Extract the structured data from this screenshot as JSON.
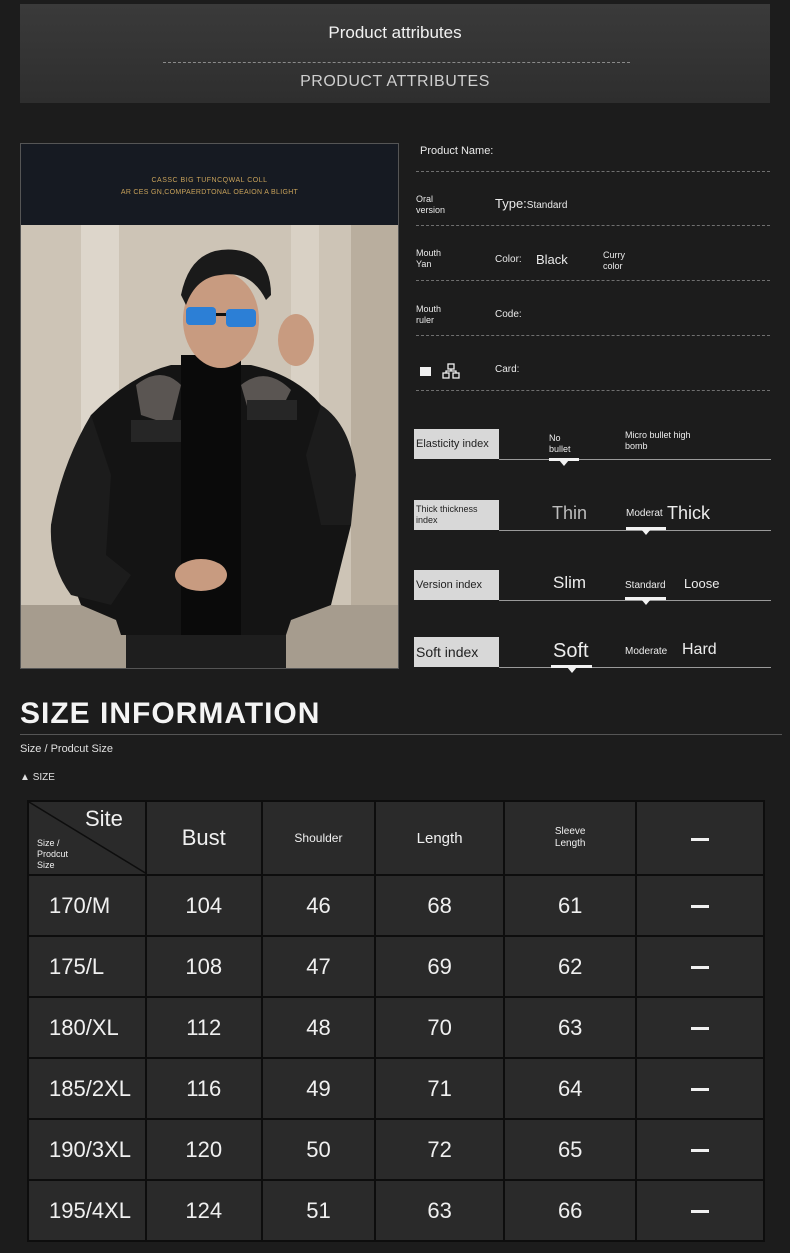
{
  "banner": {
    "title": "Product attributes",
    "subtitle": "PRODUCT ATTRIBUTES"
  },
  "photo": {
    "caption_line1": "CASSC BIG TUFNCQWAL COLL",
    "caption_line2": "AR CES GN,COMPAERDTONAL OEAION A BLIGHT"
  },
  "attributes": {
    "product_name_label": "Product Name:",
    "row1_left_line1": "Oral",
    "row1_left_line2": "version",
    "row1_type_label": "Type:",
    "row1_type_value": "Standard",
    "row2_left_line1": "Mouth",
    "row2_left_line2": "Yan",
    "row2_color_label": "Color:",
    "row2_color_value": "Black",
    "row2_right_line1": "Curry",
    "row2_right_line2": "color",
    "row3_left_line1": "Mouth",
    "row3_left_line2": "ruler",
    "row3_code_label": "Code:",
    "row4_card_label": "Card:"
  },
  "indices": {
    "elasticity": {
      "label": "Elasticity index",
      "opt1_line1": "No",
      "opt1_line2": "bullet",
      "opt2_line1": "Micro bullet high",
      "opt2_line2": "bomb"
    },
    "thickness": {
      "label_line1": "Thick thickness",
      "label_line2": "index",
      "opt1": "Thin",
      "opt2": "Moderat",
      "opt3": "Thick"
    },
    "version": {
      "label": "Version index",
      "opt1": "Slim",
      "opt2": "Standard",
      "opt3": "Loose"
    },
    "soft": {
      "label": "Soft index",
      "opt1": "Soft",
      "opt2": "Moderate",
      "opt3": "Hard"
    }
  },
  "size_info": {
    "title": "SIZE INFORMATION",
    "subtitle": "Size / Prodcut Size",
    "tag": "SIZE",
    "header": {
      "site": "Site",
      "size_line1": "Size /",
      "size_line2": "Prodcut",
      "size_line3": "Size",
      "bust": "Bust",
      "shoulder": "Shoulder",
      "length": "Length",
      "sleeve_line1": "Sleeve",
      "sleeve_line2": "Length"
    },
    "rows": [
      {
        "size": "170/M",
        "bust": "104",
        "shoulder": "46",
        "length": "68",
        "sleeve": "61"
      },
      {
        "size": "175/L",
        "bust": "108",
        "shoulder": "47",
        "length": "69",
        "sleeve": "62"
      },
      {
        "size": "180/XL",
        "bust": "112",
        "shoulder": "48",
        "length": "70",
        "sleeve": "63"
      },
      {
        "size": "185/2XL",
        "bust": "116",
        "shoulder": "49",
        "length": "71",
        "sleeve": "64"
      },
      {
        "size": "190/3XL",
        "bust": "120",
        "shoulder": "50",
        "length": "72",
        "sleeve": "65"
      },
      {
        "size": "195/4XL",
        "bust": "124",
        "shoulder": "51",
        "length": "63",
        "sleeve": "66"
      }
    ]
  }
}
